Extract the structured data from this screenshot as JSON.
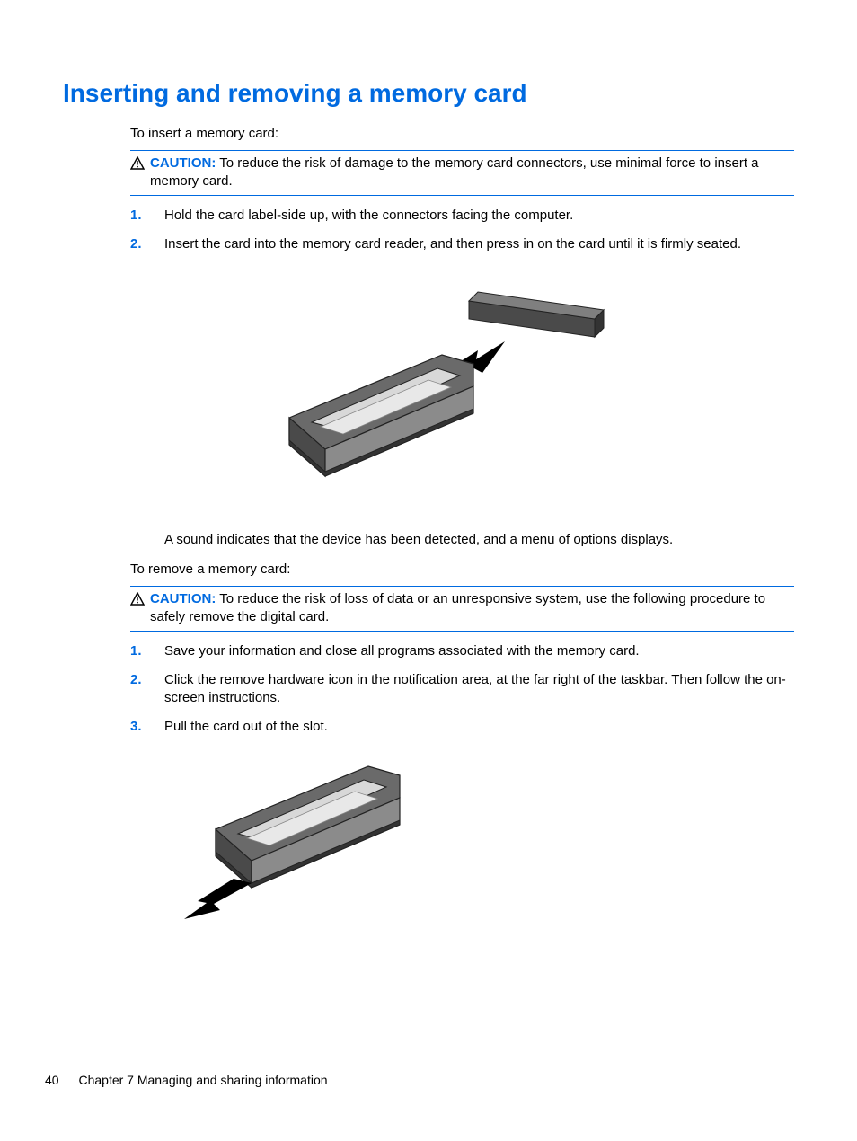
{
  "heading": "Inserting and removing a memory card",
  "intro1": "To insert a memory card:",
  "caution1": {
    "label": "CAUTION:",
    "text": "To reduce the risk of damage to the memory card connectors, use minimal force to insert a memory card."
  },
  "steps1": [
    {
      "num": "1.",
      "text": "Hold the card label-side up, with the connectors facing the computer."
    },
    {
      "num": "2.",
      "text": "Insert the card into the memory card reader, and then press in on the card until it is firmly seated."
    }
  ],
  "post_step1": "A sound indicates that the device has been detected, and a menu of options displays.",
  "intro2": "To remove a memory card:",
  "caution2": {
    "label": "CAUTION:",
    "text": "To reduce the risk of loss of data or an unresponsive system, use the following procedure to safely remove the digital card."
  },
  "steps2": [
    {
      "num": "1.",
      "text": "Save your information and close all programs associated with the memory card."
    },
    {
      "num": "2.",
      "text": "Click the remove hardware icon in the notification area, at the far right of the taskbar. Then follow the on-screen instructions."
    },
    {
      "num": "3.",
      "text": "Pull the card out of the slot."
    }
  ],
  "footer": {
    "page_number": "40",
    "chapter": "Chapter 7   Managing and sharing information"
  }
}
